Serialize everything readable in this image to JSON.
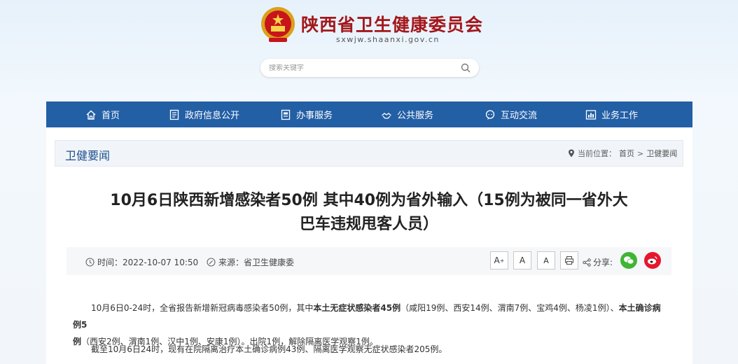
{
  "site": {
    "title": "陕西省卫生健康委员会",
    "domain": "sxwjw.shaanxi.gov.cn",
    "search_placeholder": "搜索关键字"
  },
  "nav": {
    "items": [
      {
        "label": "首页",
        "icon": "home-icon"
      },
      {
        "label": "政府信息公开",
        "icon": "document-list-icon"
      },
      {
        "label": "办事服务",
        "icon": "service-icon"
      },
      {
        "label": "公共服务",
        "icon": "public-service-icon"
      },
      {
        "label": "互动交流",
        "icon": "interaction-icon"
      },
      {
        "label": "业务工作",
        "icon": "business-icon"
      }
    ]
  },
  "section": {
    "title": "卫健要闻",
    "breadcrumb_prefix": "当前位置：",
    "breadcrumb_home": "首页",
    "breadcrumb_sep": ">",
    "breadcrumb_current": "卫健要闻"
  },
  "article": {
    "title_line1": "10月6日陕西新增感染者50例 其中40例为省外输入（15例为被同一省外大",
    "title_line2": "巴车违规甩客人员）",
    "time": "时间：2022-10-07 10:50",
    "source": "来源：省卫生健康委",
    "font_large": "A",
    "font_large_sup": "+",
    "font_medium": "A",
    "font_small": "A",
    "share_label": "分享:",
    "p1_a": "10月6日0-24时，全省报告新增新冠病毒感染者50例，其中",
    "p1_b": "本土无症状感染者45例",
    "p1_c": "（咸阳19例、西安14例、渭南7例、宝鸡4例、杨凌1例）、",
    "p1_d": "本土确诊病例5",
    "p1_e": "例",
    "p1_f": "（西安2例、渭南1例、汉中1例、安康1例）。出院1例，解除隔离医学观察1例。",
    "p2": "截至10月6日24时，现有在院隔离治疗本土确诊病例43例、隔离医学观察无症状感染者205例。"
  },
  "colors": {
    "nav_bg": "#235fa5",
    "title_red": "#a3171b",
    "wechat_green": "#3fb534",
    "weibo_red": "#e6162d"
  }
}
